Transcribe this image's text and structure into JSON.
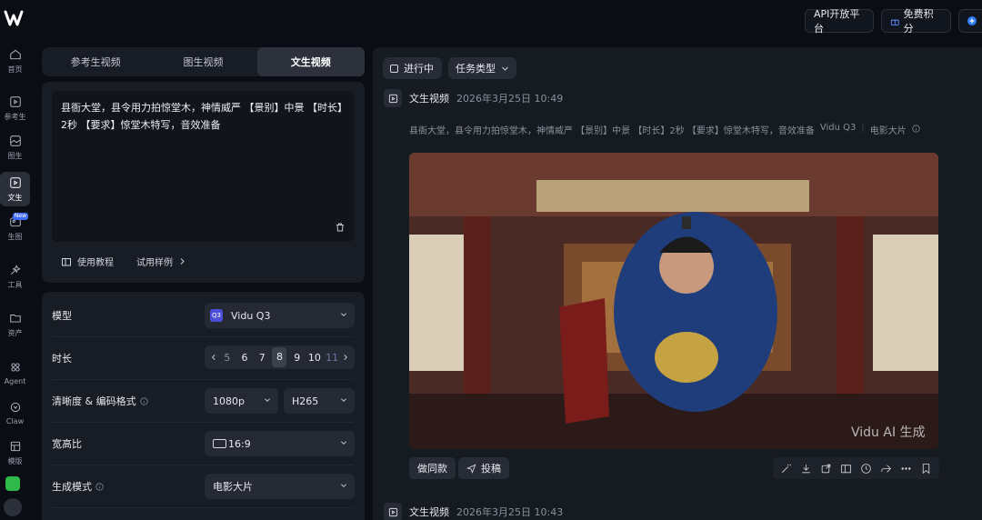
{
  "rail": {
    "items": [
      {
        "label": "首页",
        "icon": "home-icon"
      },
      {
        "label": "参考生",
        "icon": "reference-video-icon"
      },
      {
        "label": "图生",
        "icon": "image-video-icon"
      },
      {
        "label": "文生",
        "icon": "text-video-icon",
        "active": true
      },
      {
        "label": "生图",
        "icon": "image-gen-icon",
        "badge": "New"
      },
      {
        "label": "工具",
        "icon": "tools-icon"
      },
      {
        "label": "资产",
        "icon": "folder-icon"
      },
      {
        "label": "Agent",
        "icon": "agent-icon"
      },
      {
        "label": "Claw",
        "icon": "claw-icon"
      },
      {
        "label": "模版",
        "icon": "template-icon"
      }
    ]
  },
  "topbar": {
    "api_label": "API开放平台",
    "points_label": "免费积分"
  },
  "tabs": [
    {
      "label": "参考生视频"
    },
    {
      "label": "图生视频"
    },
    {
      "label": "文生视频",
      "active": true
    }
  ],
  "prompt": {
    "text": "县衙大堂，县令用力拍惊堂木，神情威严 【景别】中景 【时长】2秒 【要求】惊堂木特写，音效准备",
    "tutorial_label": "使用教程",
    "examples_label": "试用样例"
  },
  "settings": {
    "model_label": "模型",
    "model_value": "Vidu Q3",
    "model_badge": "Q3",
    "duration_label": "时长",
    "duration_options": [
      "5",
      "6",
      "7",
      "8",
      "9",
      "10",
      "11"
    ],
    "duration_selected": "8",
    "clarity_label": "清晰度 & 编码格式",
    "resolution_value": "1080p",
    "codec_value": "H265",
    "ratio_label": "宽高比",
    "ratio_value": "16:9",
    "mode_label": "生成模式",
    "mode_value": "电影大片"
  },
  "right": {
    "status_label": "进行中",
    "task_type_label": "任务类型",
    "task1": {
      "title": "文生视频",
      "time": "2026年3月25日 10:49",
      "prompt": "县衙大堂，县令用力拍惊堂木，神情威严 【景别】中景 【时长】2秒 【要求】惊堂木特写，音效准备",
      "model": "Vidu Q3",
      "mode": "电影大片",
      "watermark": "Vidu AI 生成",
      "same_label": "做同款",
      "submit_label": "投稿"
    },
    "task2": {
      "title": "文生视频",
      "time": "2026年3月25日 10:43"
    }
  },
  "colors": {
    "accent": "#3f6bff",
    "background": "#0a0d14",
    "panel": "#181c24"
  }
}
